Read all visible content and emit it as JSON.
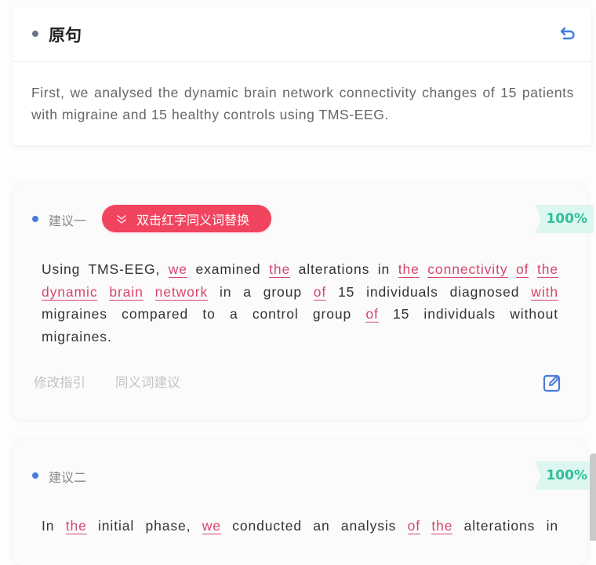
{
  "original": {
    "title": "原句",
    "text": "First, we analysed the dynamic brain network connectivity changes of 15 patients with migraine and 15 healthy controls using TMS-EEG.",
    "undo_icon": "undo-icon"
  },
  "suggestions": [
    {
      "label": "建议一",
      "synonym_button": "双击红字同义词替换",
      "score": "100%",
      "segments": [
        {
          "t": "Using TMS-EEG, ",
          "hl": false
        },
        {
          "t": "we",
          "hl": true
        },
        {
          "t": " examined ",
          "hl": false
        },
        {
          "t": "the",
          "hl": true
        },
        {
          "t": " alterations in ",
          "hl": false
        },
        {
          "t": "the",
          "hl": true
        },
        {
          "t": " ",
          "hl": false
        },
        {
          "t": "connectivity",
          "hl": true
        },
        {
          "t": " ",
          "hl": false
        },
        {
          "t": "of",
          "hl": true
        },
        {
          "t": " ",
          "hl": false
        },
        {
          "t": "the",
          "hl": true
        },
        {
          "t": " ",
          "hl": false
        },
        {
          "t": "dynamic",
          "hl": true
        },
        {
          "t": " ",
          "hl": false
        },
        {
          "t": "brain",
          "hl": true
        },
        {
          "t": " ",
          "hl": false
        },
        {
          "t": "network",
          "hl": true
        },
        {
          "t": " in a group ",
          "hl": false
        },
        {
          "t": "of",
          "hl": true
        },
        {
          "t": " 15 individuals diagnosed ",
          "hl": false
        },
        {
          "t": "with",
          "hl": true
        },
        {
          "t": " migraines compared to a control group ",
          "hl": false
        },
        {
          "t": "of",
          "hl": true
        },
        {
          "t": " 15 individuals without migraines.",
          "hl": false
        }
      ],
      "footer": {
        "guide_link": "修改指引",
        "synonym_link": "同义词建议"
      }
    },
    {
      "label": "建议二",
      "score": "100%",
      "segments": [
        {
          "t": "In ",
          "hl": false
        },
        {
          "t": "the",
          "hl": true
        },
        {
          "t": " initial phase, ",
          "hl": false
        },
        {
          "t": "we",
          "hl": true
        },
        {
          "t": " conducted an analysis ",
          "hl": false
        },
        {
          "t": "of",
          "hl": true
        },
        {
          "t": " ",
          "hl": false
        },
        {
          "t": "the",
          "hl": true
        },
        {
          "t": " alterations in",
          "hl": false
        }
      ]
    }
  ],
  "colors": {
    "accent_blue": "#4a7bdc",
    "highlight_red": "#d6456a",
    "button_red": "#f0445f",
    "score_green": "#2fbf9a",
    "score_bg": "#dcf6f0"
  }
}
